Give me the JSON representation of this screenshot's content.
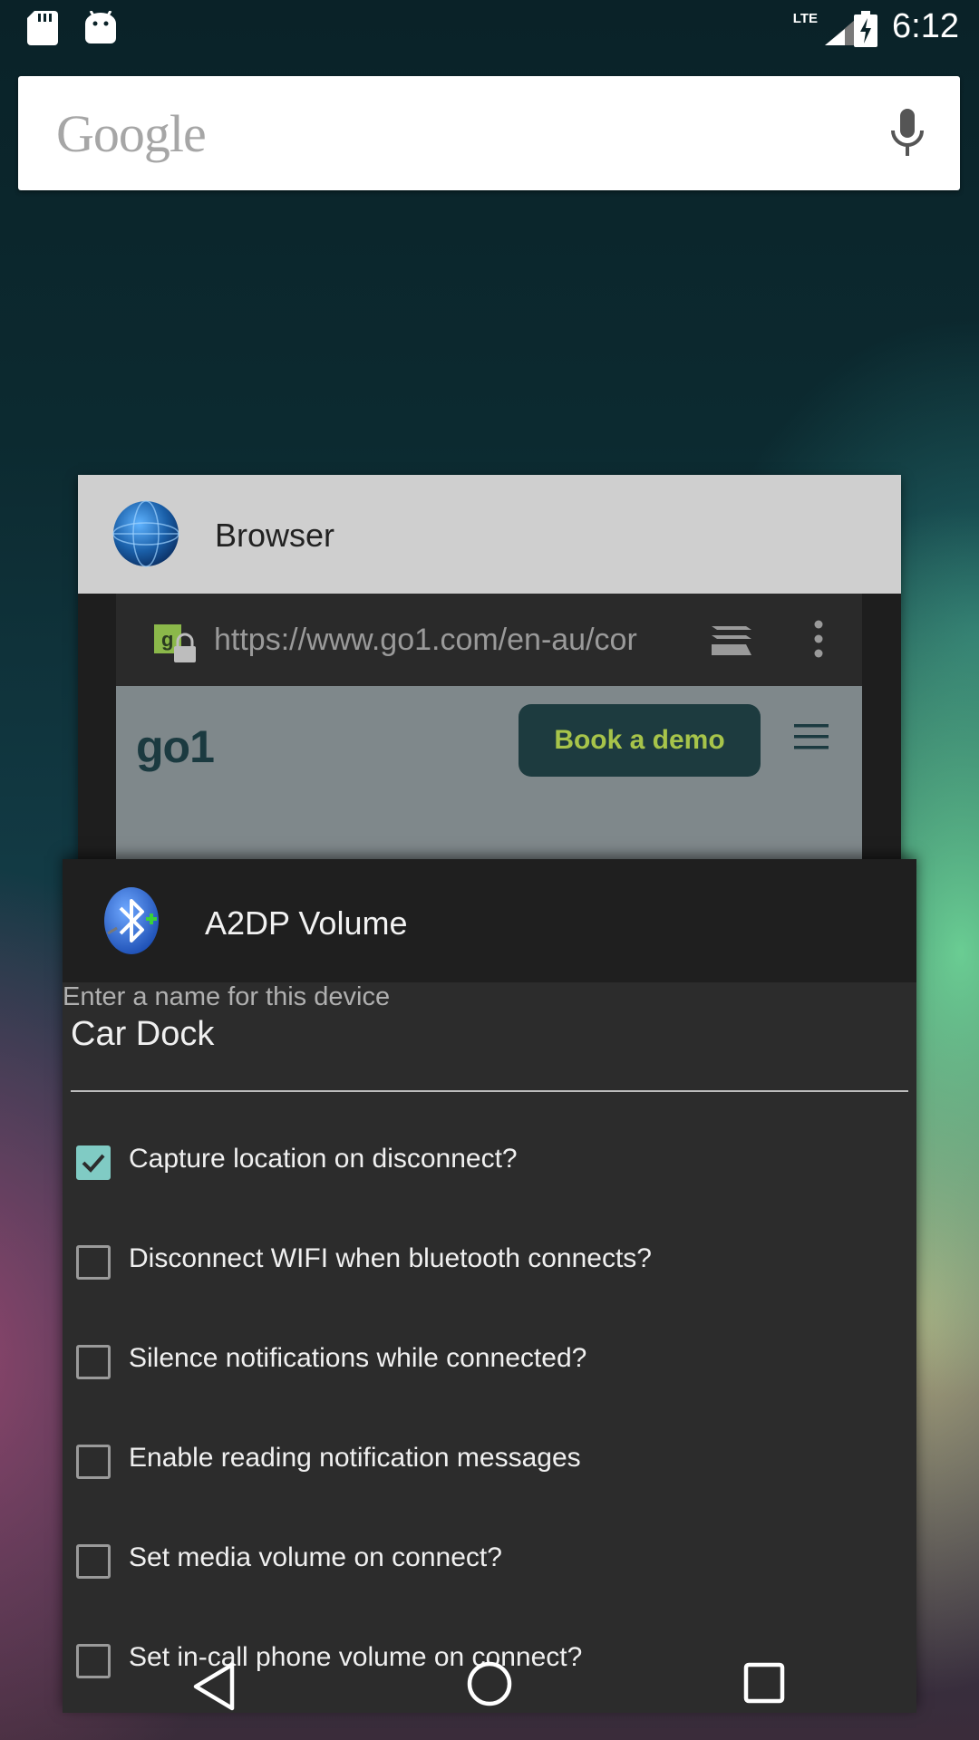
{
  "status_bar": {
    "time": "6:12",
    "network": "LTE",
    "icons": [
      "sd-card-icon",
      "android-icon",
      "signal-icon",
      "battery-charging-icon"
    ]
  },
  "search": {
    "logo": "Google",
    "mic_icon": "mic-icon"
  },
  "recents": {
    "browser_card": {
      "title": "Browser",
      "icon": "globe-icon",
      "url": "https://www.go1.com/en-au/cor",
      "page_logo": "go1",
      "page_button": "Book a demo"
    },
    "a2dp_card": {
      "title": "A2DP Volume",
      "icon": "bluetooth-icon",
      "field_label": "Enter a name for this device",
      "field_value": "Car Dock",
      "options": [
        {
          "label": "Capture location on disconnect?",
          "checked": true
        },
        {
          "label": "Disconnect WIFI when bluetooth connects?",
          "checked": false
        },
        {
          "label": "Silence notifications while connected?",
          "checked": false
        },
        {
          "label": "Enable reading notification messages",
          "checked": false
        },
        {
          "label": "Set media volume on connect?",
          "checked": false
        },
        {
          "label": "Set in-call phone volume on connect?",
          "checked": false
        }
      ]
    }
  },
  "nav": {
    "icons": [
      "back-icon",
      "home-icon",
      "recents-icon"
    ]
  },
  "colors": {
    "accent_checkbox": "#80cbc4",
    "button_bg": "#1d3b3f",
    "button_text": "#a7c44a"
  }
}
